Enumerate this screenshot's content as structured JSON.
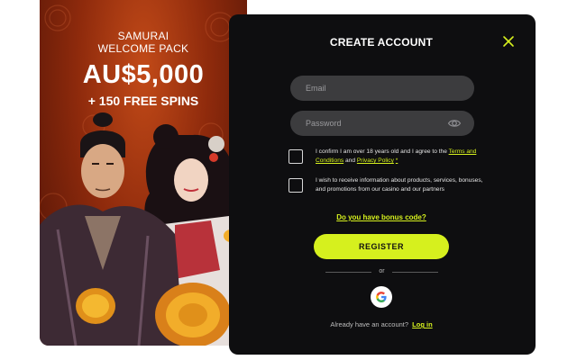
{
  "promo": {
    "subtitle_line1": "SAMURAI",
    "subtitle_line2": "WELCOME PACK",
    "amount": "AU$5,000",
    "free_spins": "+ 150 FREE SPINS",
    "colors": {
      "background": "#8e2a0c",
      "glow": "#c24a18"
    }
  },
  "form": {
    "title": "CREATE ACCOUNT",
    "close_icon": "close-icon",
    "email": {
      "placeholder": "Email",
      "value": ""
    },
    "password": {
      "placeholder": "Password",
      "value": "",
      "icon": "eye-icon"
    },
    "age_consent": {
      "text_before": "I confirm I am over 18 years old and I agree to the",
      "terms_link": "Terms and Conditions",
      "and_text": "and",
      "privacy_link": "Privacy Policy",
      "required_mark": "*",
      "checked": false
    },
    "marketing_consent": {
      "text": "I wish to receive information about products, services, bonuses, and promotions from our casino and our partners",
      "checked": false
    },
    "bonus_code_link": "Do you have bonus code?",
    "register_label": "REGISTER",
    "divider_text": "or",
    "google_icon": "google-icon",
    "login_prompt": "Already have an account?",
    "login_link": "Log in",
    "colors": {
      "accent": "#d6f01e",
      "panel": "#0e0e10",
      "field": "#3c3c3e"
    }
  }
}
